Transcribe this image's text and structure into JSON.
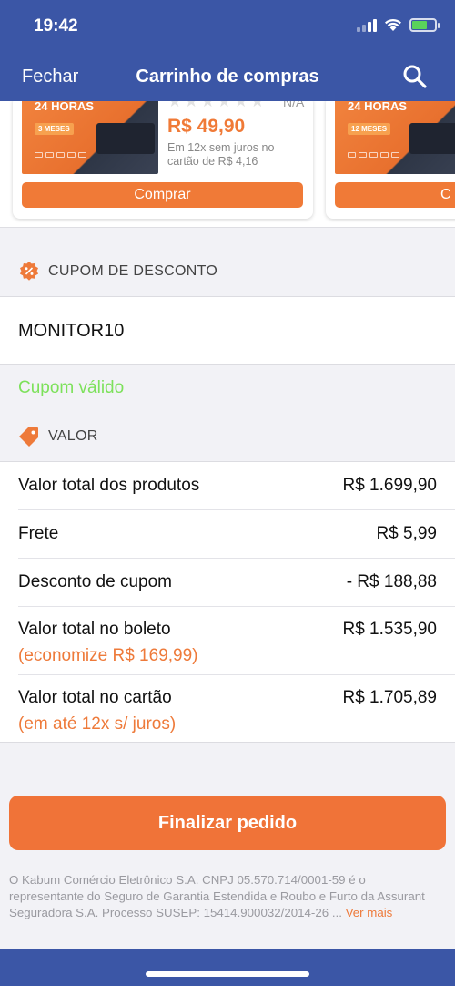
{
  "status_bar": {
    "time": "19:42"
  },
  "nav": {
    "close_label": "Fechar",
    "title": "Carrinho de compras"
  },
  "products": [
    {
      "banner_hours": "24 HORAS",
      "banner_months": "3 MESES",
      "rating": "N/A",
      "price": "R$ 49,90",
      "installments": "Em 12x sem juros no cartão de R$ 4,16",
      "buy_label": "Comprar"
    },
    {
      "banner_hours": "24 HORAS",
      "banner_months": "12 MESES",
      "buy_label": "C"
    }
  ],
  "coupon": {
    "section_label": "CUPOM DE DESCONTO",
    "code": "MONITOR10",
    "status": "Cupom válido"
  },
  "values": {
    "section_label": "VALOR",
    "rows": [
      {
        "label": "Valor total dos produtos",
        "value": "R$ 1.699,90"
      },
      {
        "label": "Frete",
        "value": "R$ 5,99"
      },
      {
        "label": "Desconto de cupom",
        "value": "- R$ 188,88"
      },
      {
        "label": "Valor total no boleto",
        "value": "R$ 1.535,90",
        "note": "(economize R$ 169,99)"
      },
      {
        "label": "Valor total no cartão",
        "value": "R$ 1.705,89",
        "note": "(em até 12x s/ juros)"
      }
    ]
  },
  "finalize_label": "Finalizar pedido",
  "legal": {
    "text": "O Kabum Comércio Eletrônico S.A. CNPJ 05.570.714/0001-59 é o representante do Seguro de Garantia Estendida e Roubo e Furto da Assurant Seguradora S.A. Processo SUSEP: 15414.900032/2014-26 ...",
    "more": "Ver mais"
  },
  "colors": {
    "header": "#3b56a6",
    "accent": "#f07a37",
    "valid": "#7de15b"
  }
}
